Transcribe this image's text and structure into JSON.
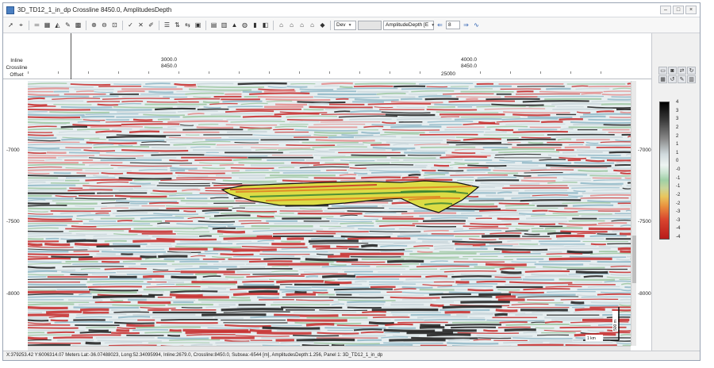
{
  "window": {
    "title": "3D_TD12_1_in_dp Crossline 8450.0, AmplitudesDepth",
    "controls": [
      "–",
      "□",
      "×"
    ]
  },
  "toolbar": {
    "groups": [
      [
        "pointer-icon",
        "zoom-cursor-icon"
      ],
      [
        "ruler-icon",
        "grid-icon",
        "shape-icon",
        "dropper-icon",
        "pattern-icon"
      ],
      [
        "zoom-in-icon",
        "zoom-out-icon",
        "zoom-fit-icon"
      ],
      [
        "check-icon",
        "cross-icon",
        "brush-icon"
      ],
      [
        "list-icon",
        "vertical-icon",
        "horizontal-icon",
        "frame-icon"
      ],
      [
        "page-icon",
        "table-icon",
        "lock-icon",
        "database-icon",
        "bars-icon",
        "panel-icon"
      ],
      [
        "house-icon",
        "house2-icon",
        "house3-icon",
        "house4-icon",
        "diamond-icon"
      ]
    ],
    "dev_label": "Dev",
    "attribute_label": "AmplitudeDepth [E",
    "step_value": "8",
    "arrow_left": "⇐",
    "arrow_right": "⇒",
    "link_glyph": "∿"
  },
  "header": {
    "row_labels": [
      "Inline",
      "Crossline",
      "Offset"
    ],
    "ticks": [
      {
        "line1": "3000.0",
        "line2": "8450.0"
      },
      {
        "line1": "4000.0",
        "line2": "8450.0"
      }
    ],
    "offset_label": "25000"
  },
  "depth_axis": {
    "labels": [
      "-7000",
      "-7500",
      "-8000"
    ]
  },
  "colorbar": {
    "labels": [
      "4",
      "3",
      "3",
      "2",
      "2",
      "1",
      "1",
      "0",
      "-0",
      "-1",
      "-1",
      "-2",
      "-2",
      "-3",
      "-3",
      "-4",
      "-4"
    ],
    "colors": {
      "top": "#000000",
      "mid": "#eef4f2",
      "yellow": "#e9c75e",
      "bottom": "#b81a1a"
    }
  },
  "scale_bar": {
    "horizontal_label": "1 km",
    "vertical_label": "500 m"
  },
  "statusbar": {
    "text": "X:379253.42   Y:6006314.07 Meters  Lat:-36.07488023, Long:52.34095994,   Inline:2679.0,  Crossline:8450.0,   Subsea:-6544 [m],  AmplitudesDepth:1.256,   Panel 1:  3D_TD12_1_in_dp"
  },
  "right_panel": {
    "tools": [
      "folder-open-icon",
      "save-icon",
      "swap-icon",
      "refresh-icon",
      "grid-small-icon",
      "reset-icon",
      "edit-icon",
      "chart-icon"
    ]
  }
}
